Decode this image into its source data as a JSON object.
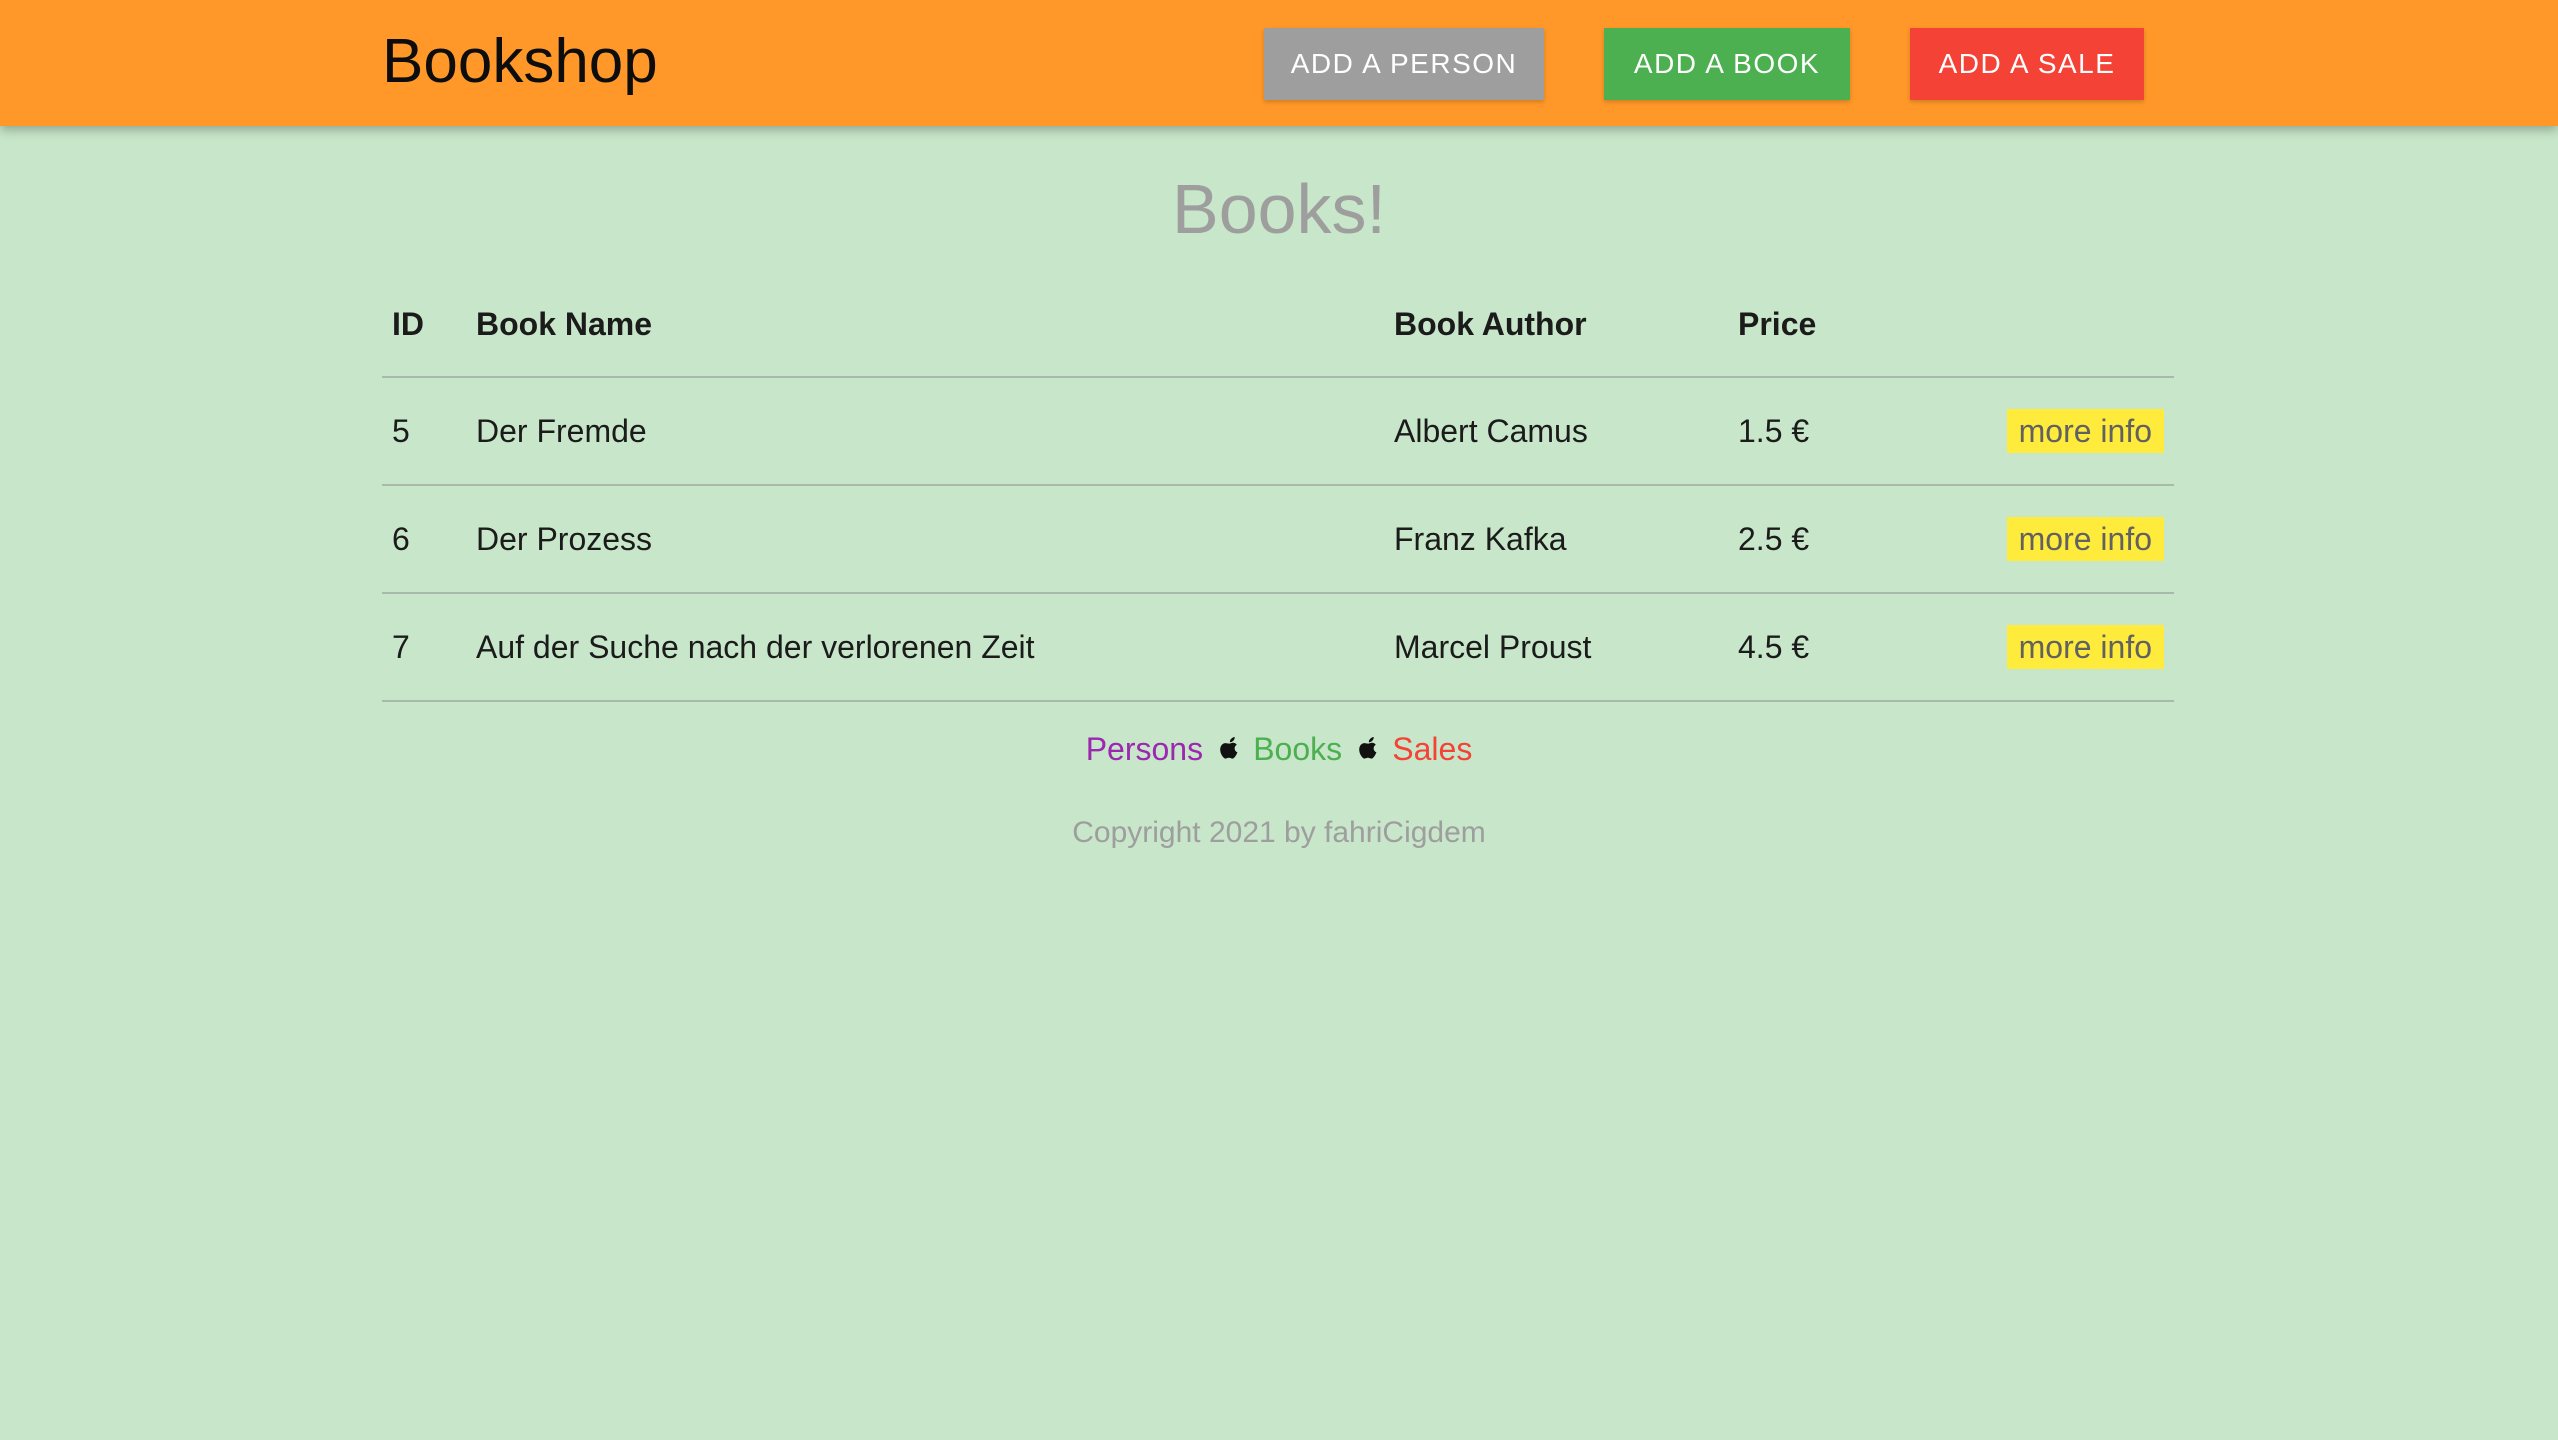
{
  "header": {
    "brand": "Bookshop",
    "buttons": {
      "add_person": "ADD A PERSON",
      "add_book": "ADD A BOOK",
      "add_sale": "ADD A SALE"
    }
  },
  "page": {
    "title": "Books!"
  },
  "table": {
    "headers": {
      "id": "ID",
      "name": "Book Name",
      "author": "Book Author",
      "price": "Price"
    },
    "rows": [
      {
        "id": "5",
        "name": "Der Fremde",
        "author": "Albert Camus",
        "price": "1.5 €",
        "action": "more info"
      },
      {
        "id": "6",
        "name": "Der Prozess",
        "author": "Franz Kafka",
        "price": "2.5 €",
        "action": "more info"
      },
      {
        "id": "7",
        "name": "Auf der Suche nach der verlorenen Zeit",
        "author": "Marcel Proust",
        "price": "4.5 €",
        "action": "more info"
      }
    ]
  },
  "footer": {
    "links": {
      "persons": "Persons",
      "books": "Books",
      "sales": "Sales"
    },
    "separator_icon": "apple-icon",
    "copyright": "Copyright 2021 by fahriCigdem"
  },
  "colors": {
    "page_bg": "#c8e6c9",
    "navbar": "#ff9828",
    "btn_person": "#9e9e9e",
    "btn_book": "#4caf50",
    "btn_sale": "#f44336",
    "more_info": "#ffeb3b"
  }
}
